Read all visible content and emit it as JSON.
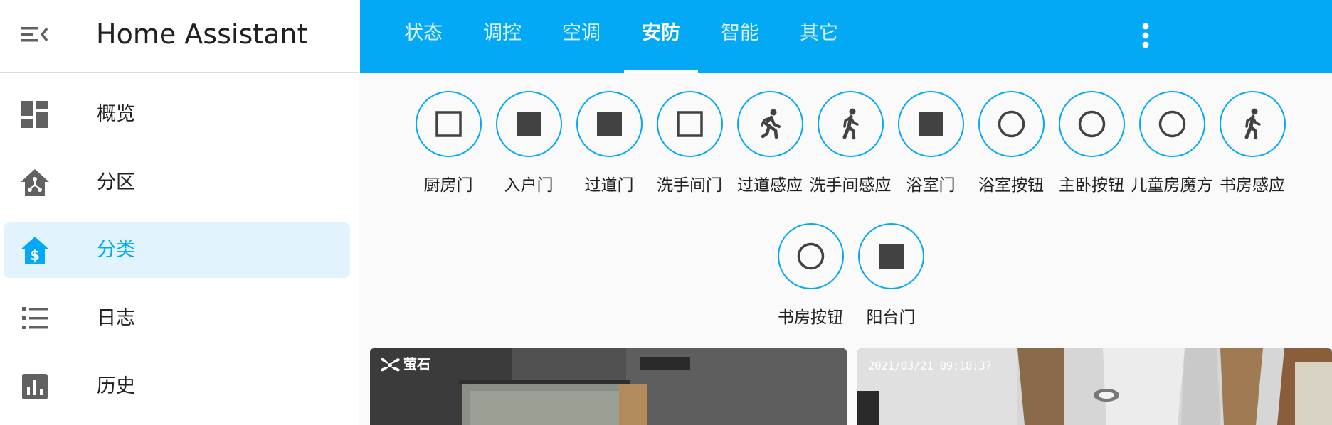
{
  "sidebar": {
    "title": "Home Assistant",
    "items": [
      {
        "label": "概览",
        "icon": "dashboard-icon"
      },
      {
        "label": "分区",
        "icon": "home-floorplan-icon"
      },
      {
        "label": "分类",
        "icon": "home-dollar-icon",
        "active": true
      },
      {
        "label": "日志",
        "icon": "list-icon"
      },
      {
        "label": "历史",
        "icon": "chart-box-icon"
      }
    ]
  },
  "tabs": [
    {
      "label": "状态"
    },
    {
      "label": "调控"
    },
    {
      "label": "空调"
    },
    {
      "label": "安防",
      "active": true
    },
    {
      "label": "智能"
    },
    {
      "label": "其它"
    }
  ],
  "entities": [
    {
      "name": "厨房门",
      "icon": "checkbox-blank-outline-icon"
    },
    {
      "name": "入户门",
      "icon": "square-icon"
    },
    {
      "name": "过道门",
      "icon": "square-icon"
    },
    {
      "name": "洗手间门",
      "icon": "checkbox-blank-outline-icon"
    },
    {
      "name": "过道感应",
      "icon": "run-icon"
    },
    {
      "name": "洗手间感应",
      "icon": "walk-icon"
    },
    {
      "name": "浴室门",
      "icon": "square-icon"
    },
    {
      "name": "浴室按钮",
      "icon": "circle-outline-icon"
    },
    {
      "name": "主卧按钮",
      "icon": "circle-outline-icon"
    },
    {
      "name": "儿童房魔方",
      "icon": "circle-outline-icon"
    },
    {
      "name": "书房感应",
      "icon": "walk-icon"
    },
    {
      "name": "书房按钮",
      "icon": "circle-outline-icon"
    },
    {
      "name": "阳台门",
      "icon": "square-icon"
    }
  ],
  "cameras": [
    {
      "brand": "萤石"
    },
    {
      "timestamp": "2021/03/21 09:18:37"
    }
  ],
  "colors": {
    "accent": "#03a9f4",
    "icon": "#424242",
    "active_bg": "#e1f4fd"
  }
}
